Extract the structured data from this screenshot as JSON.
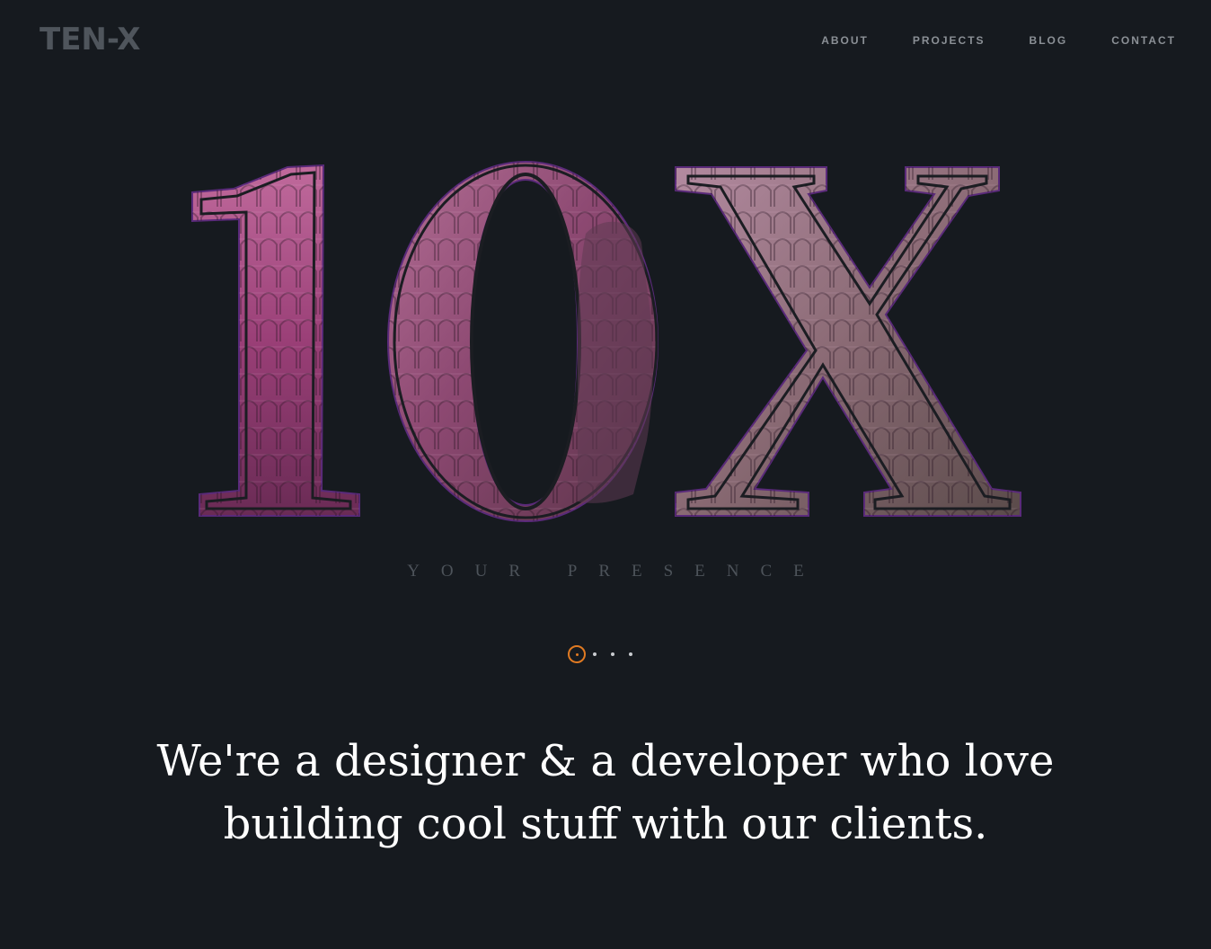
{
  "header": {
    "logo_text": "TEN-X",
    "nav": [
      {
        "label": "ABOUT"
      },
      {
        "label": "PROJECTS"
      },
      {
        "label": "BLOG"
      },
      {
        "label": "CONTACT"
      }
    ]
  },
  "hero": {
    "big_text": "10X",
    "subtitle": "YOUR PRESENCE"
  },
  "slider": {
    "active_index": 1,
    "total": 4
  },
  "tagline": {
    "line1": "We're a designer & a developer who love",
    "line2": "building cool stuff with our clients."
  },
  "colors": {
    "background": "#161a1f",
    "accent": "#e07a22",
    "letter_fill_a": "#b34f8c",
    "letter_fill_b": "#6e3f5e",
    "outline": "#5a2a7a"
  }
}
